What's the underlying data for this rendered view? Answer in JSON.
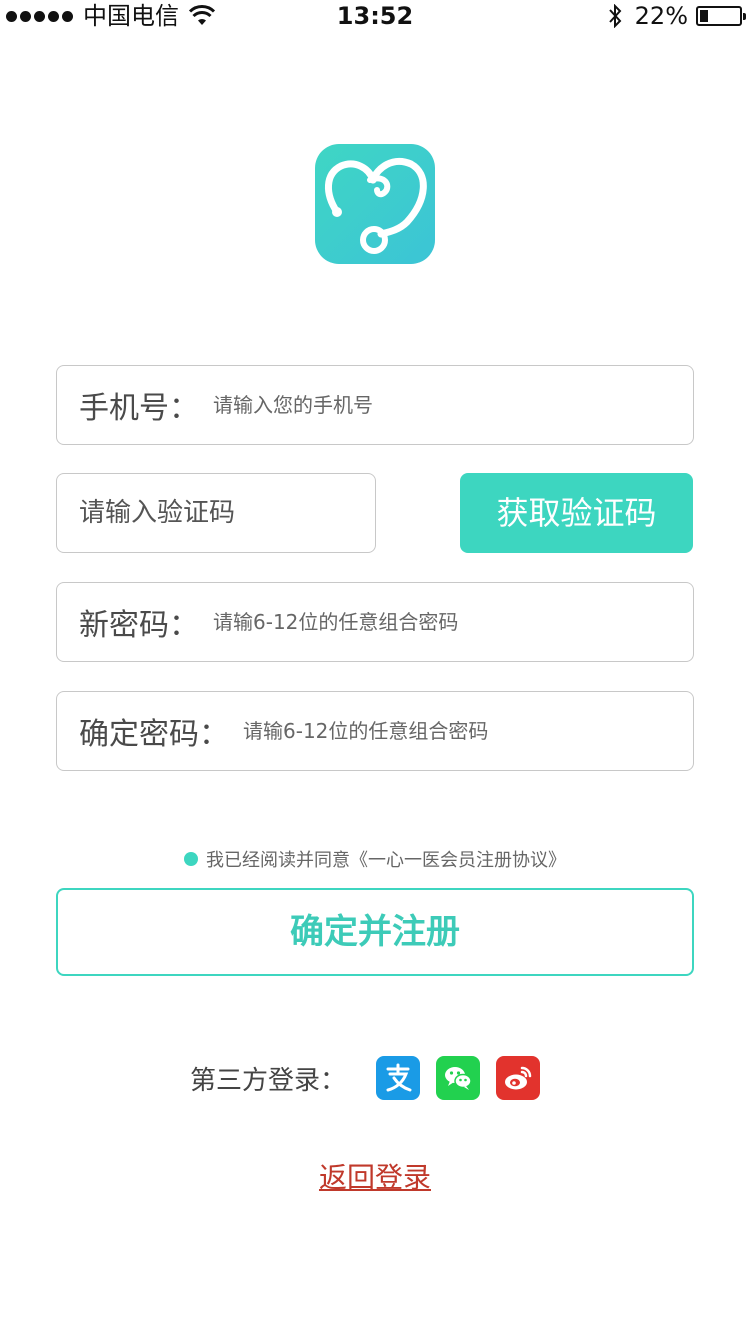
{
  "status_bar": {
    "carrier": "中国电信",
    "time": "13:52",
    "battery": "22%",
    "battery_level": 0.22
  },
  "logo": {
    "icon": "stethoscope-heart-icon",
    "accent": "#3dd6c0"
  },
  "form": {
    "phone": {
      "label": "手机号：",
      "placeholder": "请输入您的手机号"
    },
    "code": {
      "placeholder": "请输入验证码",
      "button": "获取验证码"
    },
    "new_password": {
      "label": "新密码：",
      "placeholder": "请输6-12位的任意组合密码"
    },
    "confirm_password": {
      "label": "确定密码：",
      "placeholder": "请输6-12位的任意组合密码"
    }
  },
  "agreement": {
    "text": "我已经阅读并同意《一心一医会员注册协议》"
  },
  "register_button": "确定并注册",
  "third_party": {
    "label": "第三方登录：",
    "providers": [
      {
        "name": "alipay",
        "icon": "alipay-icon",
        "color": "#1a9be6"
      },
      {
        "name": "wechat",
        "icon": "wechat-icon",
        "color": "#22d14f"
      },
      {
        "name": "weibo",
        "icon": "weibo-icon",
        "color": "#e2332d"
      }
    ]
  },
  "back_link": "返回登录"
}
